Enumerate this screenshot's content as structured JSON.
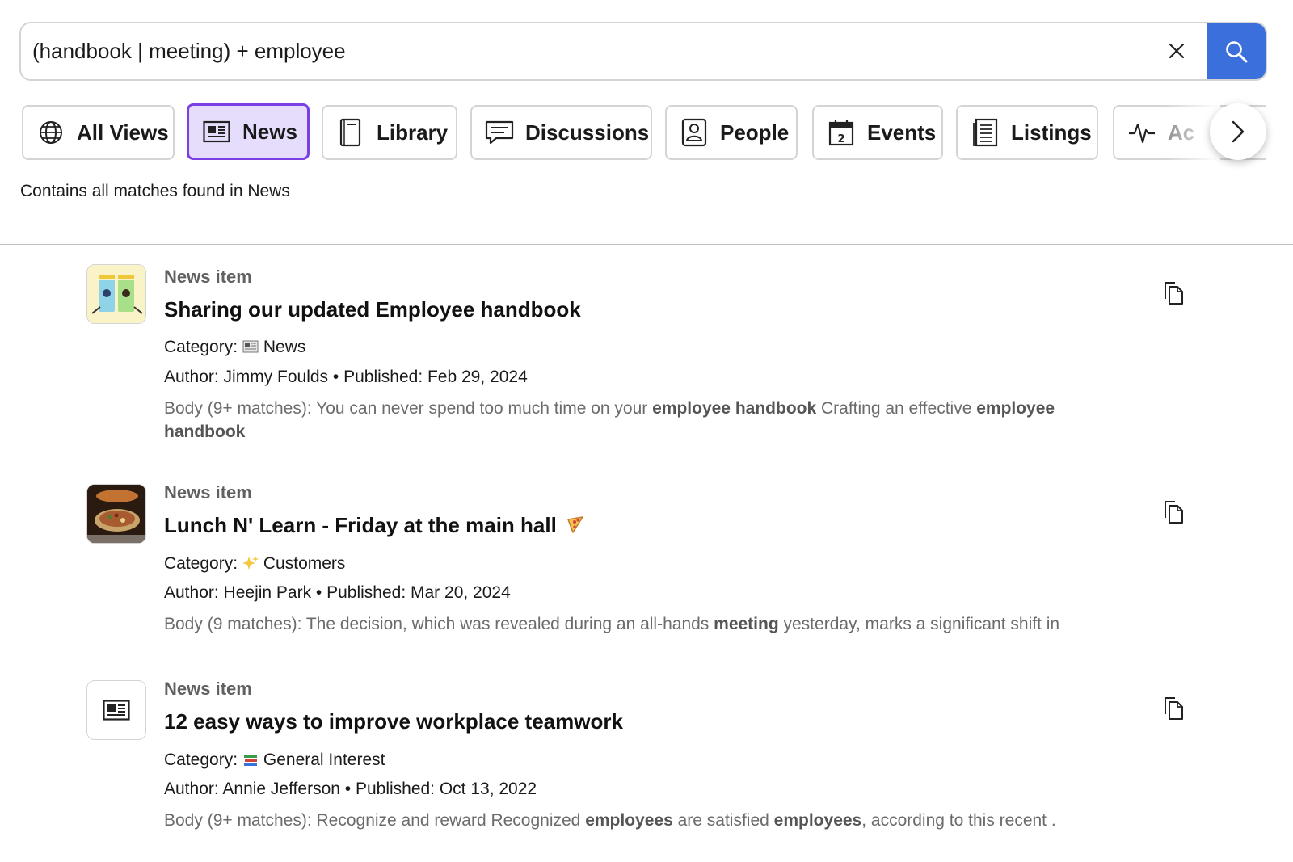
{
  "search": {
    "query": "(handbook | meeting) + employee"
  },
  "tabs": [
    {
      "label": "All Views",
      "icon": "globe-icon"
    },
    {
      "label": "News",
      "icon": "news-icon",
      "active": true
    },
    {
      "label": "Library",
      "icon": "library-icon"
    },
    {
      "label": "Discussions",
      "icon": "discussions-icon"
    },
    {
      "label": "People",
      "icon": "people-icon"
    },
    {
      "label": "Events",
      "icon": "calendar-icon"
    },
    {
      "label": "Listings",
      "icon": "listings-icon"
    },
    {
      "label": "Ac",
      "icon": "activity-icon"
    }
  ],
  "hint": "Contains all matches found in News",
  "results": [
    {
      "type": "News item",
      "title": "Sharing our updated Employee handbook",
      "category_label": "Category:",
      "category": "News",
      "author_line": "Author: Jimmy Foulds • Published: Feb 29, 2024",
      "body": [
        {
          "t": "Body (9+ matches): You can never spend too much time on your ",
          "b": false
        },
        {
          "t": "employee handbook",
          "b": true
        },
        {
          "t": " Crafting an effective ",
          "b": false
        },
        {
          "t": "employee handbook",
          "b": true
        }
      ]
    },
    {
      "type": "News item",
      "title": "Lunch N' Learn - Friday at the main hall",
      "category_label": "Category:",
      "category": "Customers",
      "author_line": "Author: Heejin Park • Published: Mar 20, 2024",
      "body": [
        {
          "t": "Body (9 matches): The decision, which was revealed during an all-hands ",
          "b": false
        },
        {
          "t": "meeting",
          "b": true
        },
        {
          "t": " yesterday, marks a significant shift in",
          "b": false
        }
      ]
    },
    {
      "type": "News item",
      "title": "12 easy ways to improve workplace teamwork",
      "category_label": "Category:",
      "category": "General Interest",
      "author_line": "Author: Annie Jefferson • Published: Oct 13, 2022",
      "body": [
        {
          "t": "Body (9+ matches): Recognize and reward Recognized ",
          "b": false
        },
        {
          "t": "employees",
          "b": true
        },
        {
          "t": " are satisfied ",
          "b": false
        },
        {
          "t": "employees",
          "b": true
        },
        {
          "t": ", according to this recent .",
          "b": false
        }
      ]
    }
  ],
  "colors": {
    "accent": "#3b6fdc",
    "active_tab_border": "#7b3fe4",
    "active_tab_bg": "#e5ddfb"
  }
}
